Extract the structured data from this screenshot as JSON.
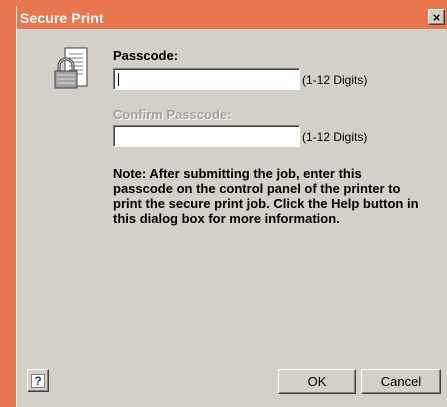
{
  "window": {
    "title": "Secure Print",
    "close_glyph": "×",
    "titlebar_color": "#e8764f",
    "background_color": "#d4d0c8"
  },
  "icon": {
    "name": "lock-document-icon"
  },
  "passcode": {
    "label": "Passcode:",
    "value": "",
    "hint": "(1-12 Digits)"
  },
  "confirm_passcode": {
    "label": "Confirm Passcode:",
    "value": "",
    "hint": "(1-12 Digits)",
    "disabled": true
  },
  "note": "Note: After submitting the job, enter this passcode on the control panel of the printer to print the secure print job.  Click the Help button in this dialog box for more information.",
  "buttons": {
    "help_glyph": "?",
    "ok": "OK",
    "cancel": "Cancel"
  }
}
